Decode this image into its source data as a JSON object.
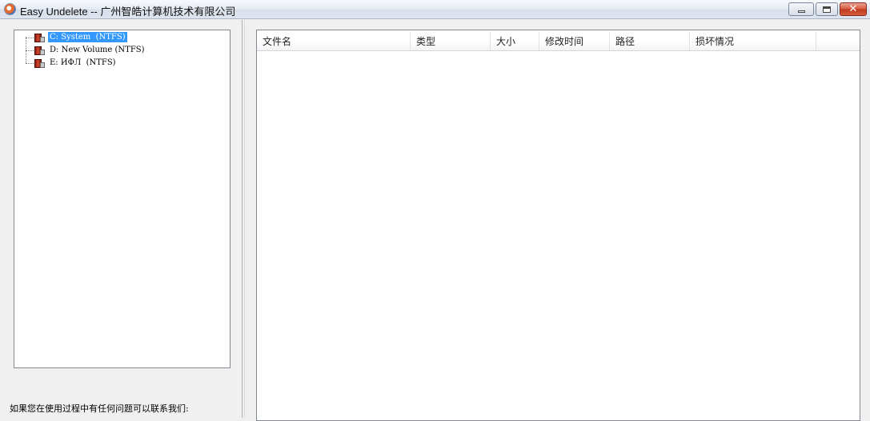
{
  "window": {
    "title": "Easy Undelete -- 广州智皓计算机技术有限公司",
    "minimize_label": "",
    "maximize_label": "",
    "close_label": "✕"
  },
  "tree": {
    "items": [
      {
        "label": "C: System  (NTFS)",
        "selected": true
      },
      {
        "label": "D: New Volume (NTFS)",
        "selected": false
      },
      {
        "label": "E: ИФЛ  (NTFS)",
        "selected": false
      }
    ]
  },
  "status": {
    "contact_text": "如果您在使用过程中有任何问题可以联系我们:"
  },
  "file_list": {
    "columns": [
      {
        "label": "文件名"
      },
      {
        "label": "类型"
      },
      {
        "label": "大小"
      },
      {
        "label": "修改时间"
      },
      {
        "label": "路径"
      },
      {
        "label": "损坏情况"
      }
    ],
    "rows": []
  },
  "colors": {
    "selection": "#3399ff",
    "window_bg": "#f0f0f0",
    "close_button": "#c0391d"
  },
  "icons": {
    "app": "app-logo-icon",
    "drive": "drive-icon"
  }
}
